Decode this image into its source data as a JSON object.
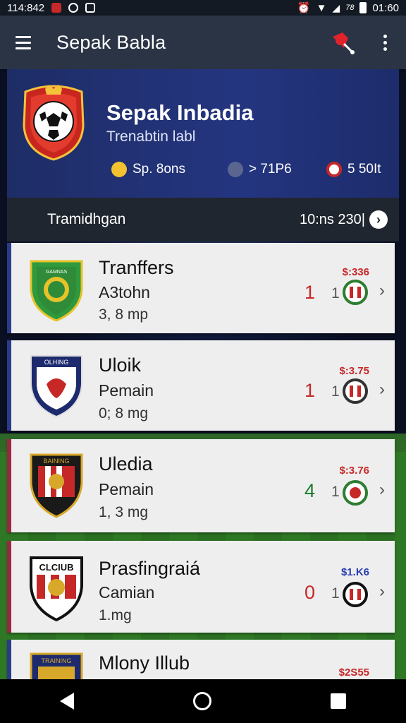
{
  "status_bar": {
    "time_left": "114:842",
    "battery_text": "78",
    "time_right": "01:60"
  },
  "app_bar": {
    "title": "Sepak Babla"
  },
  "hero": {
    "title": "Sepak Inbadia",
    "subtitle": "Trenabtin labl",
    "stats": [
      {
        "icon": "coin-icon",
        "text": "Sp. 8ons"
      },
      {
        "icon": "transfer-icon",
        "text": "> 71P6"
      },
      {
        "icon": "ball-icon",
        "text": "5 50It"
      }
    ]
  },
  "section": {
    "title": "Tramidhgan",
    "count": "10:ns 230|"
  },
  "items": [
    {
      "name": "Tranffers",
      "role": "A3tohn",
      "meta": "3, 8 mp",
      "price": "$:336",
      "score": "1",
      "count": "1",
      "score_color": "#c62828",
      "price_color": "#c62828"
    },
    {
      "name": "Uloik",
      "role": "Pemain",
      "meta": "0; 8 mg",
      "price": "$:3.75",
      "score": "1",
      "count": "1",
      "score_color": "#c62828",
      "price_color": "#c62828"
    },
    {
      "name": "Uledia",
      "role": "Pemain",
      "meta": "1, 3 mg",
      "price": "$:3.76",
      "score": "4",
      "count": "1",
      "score_color": "#1b7a2a",
      "price_color": "#c62828"
    },
    {
      "name": "Prasfingraiá",
      "role": "Camian",
      "meta": "1.mg",
      "price": "$1.K6",
      "score": "0",
      "count": "1",
      "score_color": "#c62828",
      "price_color": "#2a3fb0"
    },
    {
      "name": "Mlony Illub",
      "role": "",
      "meta": "",
      "price": "$2S55",
      "score": "",
      "count": "",
      "score_color": "#c62828",
      "price_color": "#c62828"
    }
  ],
  "crest_texts": [
    "GAMNAS",
    "OLHING",
    "BAINING",
    "CLCIUB",
    "TRAINING"
  ],
  "colors": {
    "app_bar": "#2a3445",
    "hero": "#243580",
    "card_border": "#2a3b88",
    "nav": "#000000"
  }
}
